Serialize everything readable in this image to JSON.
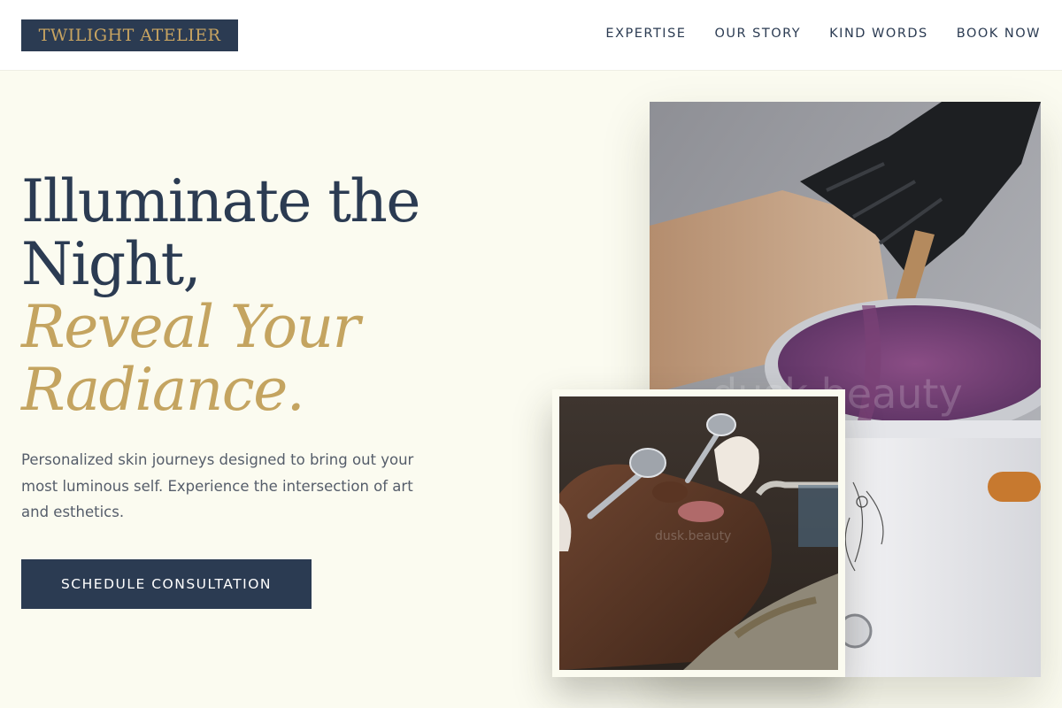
{
  "header": {
    "logo": "TWILIGHT ATELIER",
    "nav": [
      "EXPERTISE",
      "OUR STORY",
      "KIND WORDS",
      "BOOK NOW"
    ]
  },
  "hero": {
    "title_lines": [
      "Illuminate the",
      "Night,"
    ],
    "accent_lines": [
      "Reveal Your",
      "Radiance."
    ],
    "description": "Personalized skin journeys designed to bring out your most luminous self. Experience the intersection of art and esthetics.",
    "cta_label": "SCHEDULE CONSULTATION"
  },
  "images": {
    "main_watermark": "dusk.beauty",
    "inset_watermark": "dusk.beauty"
  },
  "colors": {
    "navy": "#2b3b52",
    "gold": "#c4a460",
    "background": "#fbfbf0"
  }
}
